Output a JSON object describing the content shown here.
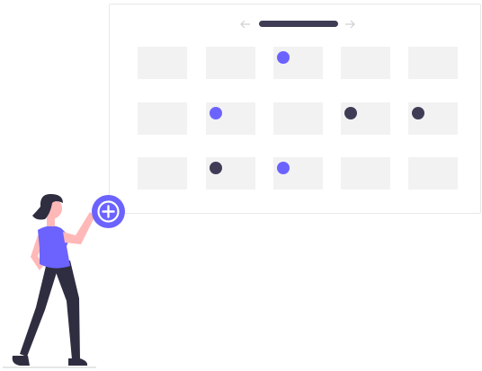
{
  "colors": {
    "accent": "#6c63ff",
    "dark": "#3f3d56",
    "cell": "#f2f2f2",
    "border": "#e8e8e8",
    "skin": "#ffb8b8",
    "hair": "#2f2e41"
  },
  "calendar": {
    "prev_icon": "arrow-left-icon",
    "next_icon": "arrow-right-icon",
    "rows": [
      [
        {
          "event": null
        },
        {
          "event": null
        },
        {
          "event": "accent"
        },
        {
          "event": null
        },
        {
          "event": null
        }
      ],
      [
        {
          "event": null
        },
        {
          "event": "accent"
        },
        {
          "event": null
        },
        {
          "event": "dark"
        },
        {
          "event": "dark"
        }
      ],
      [
        {
          "event": null
        },
        {
          "event": "dark"
        },
        {
          "event": "accent"
        },
        {
          "event": null
        },
        {
          "event": null
        }
      ]
    ]
  },
  "add_button": {
    "icon": "plus-icon"
  },
  "illustration": {
    "subject": "person-reaching-icon"
  }
}
